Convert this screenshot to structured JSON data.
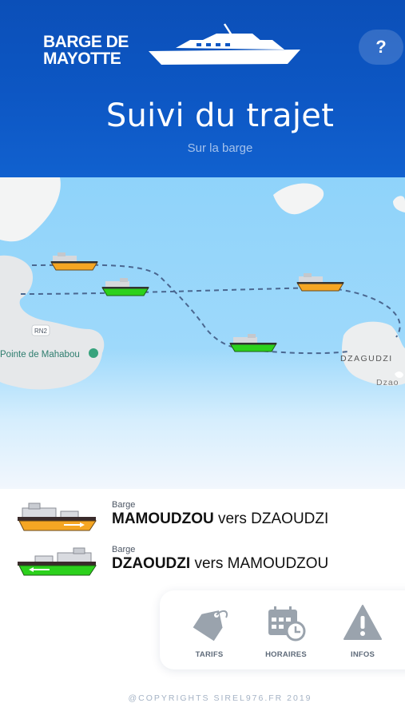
{
  "header": {
    "logo_line1": "BARGE DE",
    "logo_line2": "MAYOTTE",
    "help_label": "?",
    "title": "Suivi du trajet",
    "subtitle": "Sur la barge"
  },
  "map": {
    "labels": {
      "road": "RN2",
      "poi": "Pointe de Mahabou",
      "town": "DZAGUDZI",
      "town_partial": "Dzao"
    }
  },
  "legend": [
    {
      "small": "Barge",
      "from": "MAMOUDZOU",
      "vers": "vers",
      "to": "DZAOUDZI",
      "color": "#f5a623"
    },
    {
      "small": "Barge",
      "from": "DZAOUDZI",
      "vers": "vers",
      "to": "MAMOUDZOU",
      "color": "#2cd11c"
    }
  ],
  "nav": {
    "items": [
      {
        "label": "TARIFS",
        "icon": "tag-icon"
      },
      {
        "label": "HORAIRES",
        "icon": "calendar-clock-icon"
      },
      {
        "label": "INFOS",
        "icon": "warning-icon"
      }
    ]
  },
  "footer": {
    "copyright": "@COPYRIGHTS SIREL976.FR  2019"
  },
  "colors": {
    "header_blue": "#0d57c4",
    "sea": "#8fd3fa",
    "orange_barge": "#f5a623",
    "green_barge": "#2cd11c"
  }
}
